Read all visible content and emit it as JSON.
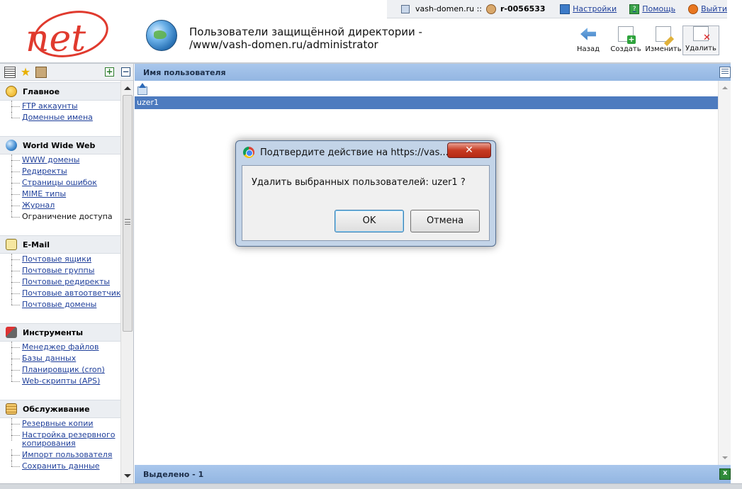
{
  "topbar": {
    "domain": "vash-domen.ru ::",
    "account": "r-0056533",
    "settings": "Настройки",
    "help": "Помощь",
    "logout": "Выйти"
  },
  "header": {
    "logo": "net",
    "title_line1": "Пользователи защищённой директории -",
    "title_line2": "/www/vash-domen.ru/administrator"
  },
  "toolbar": {
    "back": "Назад",
    "create": "Создать",
    "edit": "Изменить",
    "delete": "Удалить"
  },
  "sidebar": {
    "sections": [
      {
        "title": "Главное",
        "items": [
          "FTP аккаунты",
          "Доменные имена"
        ]
      },
      {
        "title": "World Wide Web",
        "items": [
          "WWW домены",
          "Редиректы",
          "Страницы ошибок",
          "MIME типы",
          "Журнал",
          "Ограничение доступа"
        ]
      },
      {
        "title": "E-Mail",
        "items": [
          "Почтовые ящики",
          "Почтовые группы",
          "Почтовые редиректы",
          "Почтовые автоответчики",
          "Почтовые домены"
        ]
      },
      {
        "title": "Инструменты",
        "items": [
          "Менеджер файлов",
          "Базы данных",
          "Планировщик (cron)",
          "Web-скрипты (APS)"
        ]
      },
      {
        "title": "Обслуживание",
        "items": [
          "Резервные копии",
          "Настройка резервного копирования",
          "Импорт пользователя",
          "Сохранить данные"
        ]
      }
    ]
  },
  "grid": {
    "column_header": "Имя пользователя",
    "rows": [
      "uzer1"
    ],
    "footer": "Выделено - 1"
  },
  "dialog": {
    "title": "Подтвердите действие на https://vas...",
    "close": "✕",
    "message": "Удалить выбранных пользователей:  uzer1 ?",
    "ok": "OK",
    "cancel": "Отмена"
  }
}
